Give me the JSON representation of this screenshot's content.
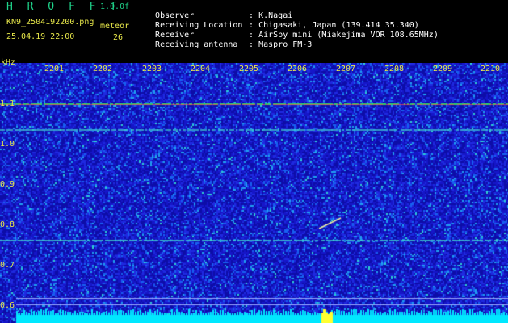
{
  "header": {
    "brand": "H R O F F T",
    "version": "1.0.0f",
    "filename": "KN9_2504192200.png",
    "meteor_label": "meteor",
    "datetime": "25.04.19 22:00",
    "meteor_count": "26"
  },
  "station": [
    {
      "key": "Observer",
      "value": ": K.Nagai"
    },
    {
      "key": "Receiving Location",
      "value": ": Chigasaki, Japan (139.414 35.340)"
    },
    {
      "key": "Receiver",
      "value": ": AirSpy mini (Miakejima VOR 108.65MHz)"
    },
    {
      "key": "Receiving antenna",
      "value": ": Maspro FM-3"
    }
  ],
  "axis": {
    "unit": "kHz",
    "y_ticks": [
      "1.1",
      "1.0",
      "0.9",
      "0.8",
      "0.7",
      "0.6"
    ],
    "x_ticks": [
      "2201",
      "2202",
      "2203",
      "2204",
      "2205",
      "2206",
      "2207",
      "2208",
      "2209",
      "2210"
    ]
  },
  "colors": {
    "background": "#0a0a88",
    "noise_low": "#1a1ad0",
    "noise_mid": "#20b0f0",
    "signal": "#ff5050",
    "baseline": "#00e8ff",
    "label": "#e8e84a",
    "brand": "#1fd38a"
  }
}
